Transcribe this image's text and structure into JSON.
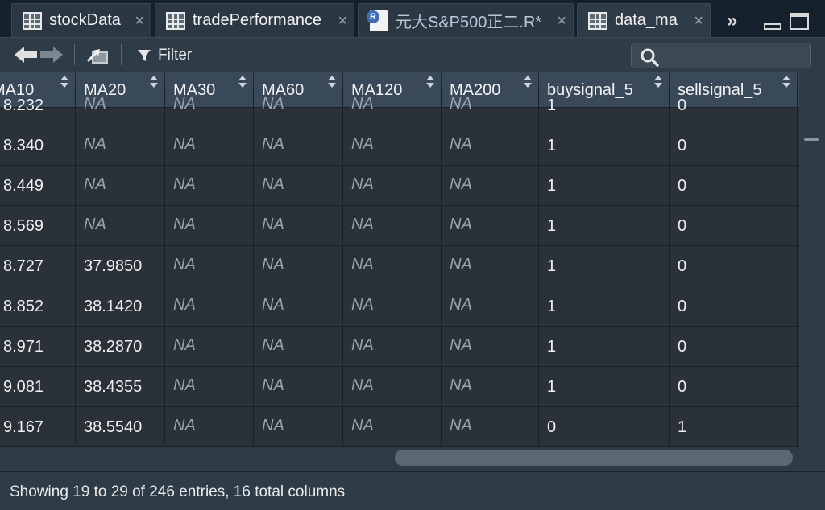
{
  "tabs": [
    {
      "label": "stockData",
      "icon": "grid-icon",
      "close": "×"
    },
    {
      "label": "tradePerformance",
      "icon": "grid-icon",
      "close": "×"
    },
    {
      "label": "元大S&P500正二.R*",
      "icon": "r-file-icon",
      "icon_text": "R",
      "close": "×"
    },
    {
      "label": "data_ma",
      "icon": "grid-icon",
      "close": "×",
      "active": true
    }
  ],
  "tab_overflow": "»",
  "toolbar": {
    "filter_label": "Filter",
    "search_placeholder": ""
  },
  "table": {
    "columns": [
      "MA10",
      "MA20",
      "MA30",
      "MA60",
      "MA120",
      "MA200",
      "buysignal_5",
      "sellsignal_5"
    ],
    "partial_row": [
      "8.232",
      "NA",
      "NA",
      "NA",
      "NA",
      "NA",
      "1",
      "0"
    ],
    "rows": [
      [
        "8.340",
        "NA",
        "NA",
        "NA",
        "NA",
        "NA",
        "1",
        "0"
      ],
      [
        "8.449",
        "NA",
        "NA",
        "NA",
        "NA",
        "NA",
        "1",
        "0"
      ],
      [
        "8.569",
        "NA",
        "NA",
        "NA",
        "NA",
        "NA",
        "1",
        "0"
      ],
      [
        "8.727",
        "37.9850",
        "NA",
        "NA",
        "NA",
        "NA",
        "1",
        "0"
      ],
      [
        "8.852",
        "38.1420",
        "NA",
        "NA",
        "NA",
        "NA",
        "1",
        "0"
      ],
      [
        "8.971",
        "38.2870",
        "NA",
        "NA",
        "NA",
        "NA",
        "1",
        "0"
      ],
      [
        "9.081",
        "38.4355",
        "NA",
        "NA",
        "NA",
        "NA",
        "1",
        "0"
      ],
      [
        "9.167",
        "38.5540",
        "NA",
        "NA",
        "NA",
        "NA",
        "0",
        "1"
      ]
    ]
  },
  "status": {
    "text": "Showing 19 to 29 of 246 entries, 16 total columns"
  },
  "colors": {
    "background": "#1f2a35",
    "header": "#39495a",
    "row": "#2a3139",
    "na_text": "#9aa3ab"
  }
}
